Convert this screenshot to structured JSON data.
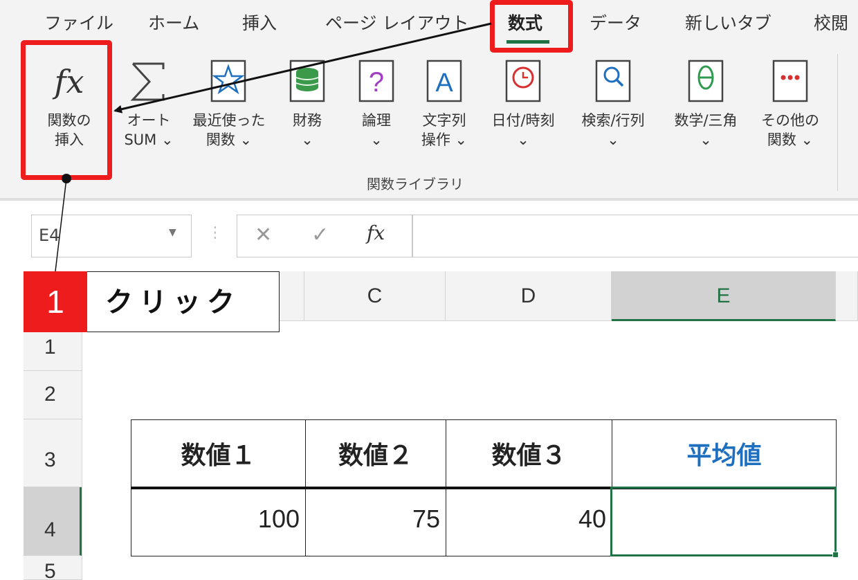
{
  "ribbon": {
    "tabs": [
      {
        "label": "ファイル"
      },
      {
        "label": "ホーム"
      },
      {
        "label": "挿入"
      },
      {
        "label": "ページ レイアウト"
      },
      {
        "label": "数式"
      },
      {
        "label": "データ"
      },
      {
        "label": "新しいタブ"
      },
      {
        "label": "校閲"
      }
    ],
    "active_tab": "数式",
    "buttons": [
      {
        "line1": "関数の",
        "line2": "挿入",
        "icon": "function-fx-icon"
      },
      {
        "line1": "オート",
        "line2": "SUM ⌄",
        "icon": "sigma-icon"
      },
      {
        "line1": "最近使った",
        "line2": "関数 ⌄",
        "icon": "star-book-icon"
      },
      {
        "line1": "財務",
        "line2": "⌄",
        "icon": "coins-book-icon"
      },
      {
        "line1": "論理",
        "line2": "⌄",
        "icon": "question-book-icon"
      },
      {
        "line1": "文字列",
        "line2": "操作 ⌄",
        "icon": "text-a-book-icon"
      },
      {
        "line1": "日付/時刻",
        "line2": "⌄",
        "icon": "clock-book-icon"
      },
      {
        "line1": "検索/行列",
        "line2": "⌄",
        "icon": "magnifier-book-icon"
      },
      {
        "line1": "数学/三角",
        "line2": "⌄",
        "icon": "theta-book-icon"
      },
      {
        "line1": "その他の",
        "line2": "関数 ⌄",
        "icon": "more-dots-book-icon"
      }
    ],
    "group_label": "関数ライブラリ"
  },
  "formula_bar": {
    "name_box": "E4",
    "fx_label": "fx",
    "formula": ""
  },
  "grid": {
    "columns": [
      "C",
      "D",
      "E"
    ],
    "selected_column": "E",
    "rows": [
      "1",
      "2",
      "3",
      "4",
      "5"
    ],
    "selected_row": "4"
  },
  "table": {
    "headers": [
      "数値１",
      "数値２",
      "数値３",
      "平均値"
    ],
    "values": [
      "100",
      "75",
      "40",
      ""
    ]
  },
  "annotation": {
    "step_number": "1",
    "step_text": "クリック",
    "highlight_color": "#ee1c1c"
  },
  "colors": {
    "excel_green": "#217346",
    "average_header_blue": "#1f6fbf"
  }
}
